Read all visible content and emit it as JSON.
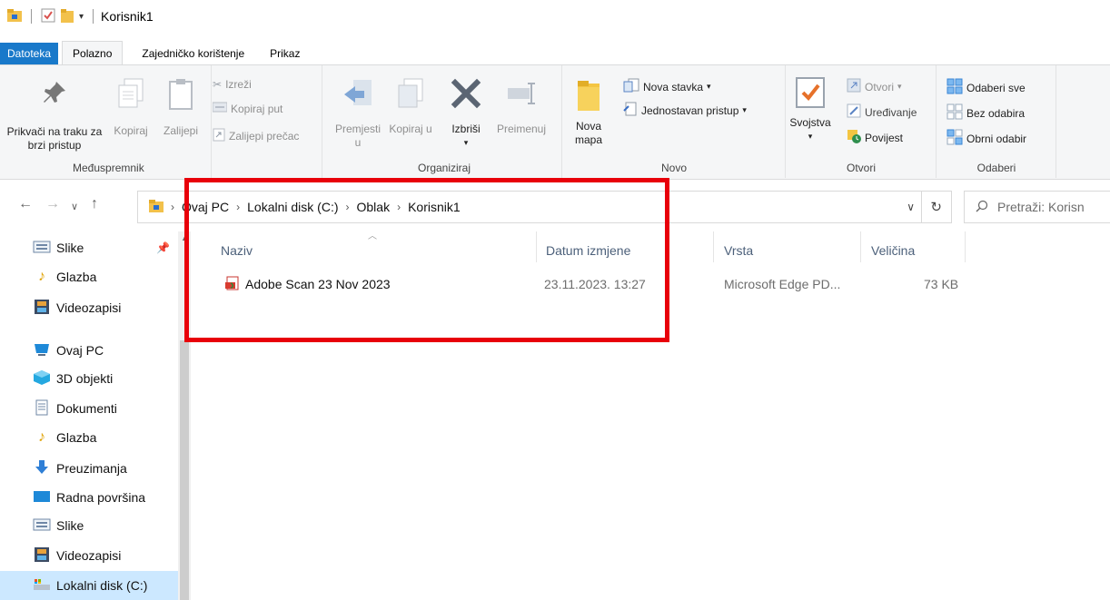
{
  "window": {
    "title": "Korisnik1"
  },
  "tabs": [
    "Datoteka",
    "Polazno",
    "Zajedničko korištenje",
    "Prikaz"
  ],
  "ribbon": {
    "clipboard": {
      "pin_label": "Prikvači na traku za brzi pristup",
      "copy": "Kopiraj",
      "paste": "Zalijepi",
      "cut": "Izreži",
      "copy_path": "Kopiraj put",
      "paste_shortcut": "Zalijepi prečac",
      "group": "Međuspremnik"
    },
    "organize": {
      "move_to": "Premjesti u",
      "copy_to": "Kopiraj u",
      "delete": "Izbriši",
      "rename": "Preimenuj",
      "group": "Organiziraj"
    },
    "new": {
      "new_folder": "Nova mapa",
      "new_item": "Nova stavka",
      "easy_access": "Jednostavan pristup",
      "group": "Novo"
    },
    "open": {
      "properties": "Svojstva",
      "open": "Otvori",
      "edit": "Uređivanje",
      "history": "Povijest",
      "group": "Otvori"
    },
    "select": {
      "select_all": "Odaberi sve",
      "select_none": "Bez odabira",
      "invert": "Obrni odabir",
      "group": "Odaberi"
    }
  },
  "address": {
    "crumbs": [
      "Ovaj PC",
      "Lokalni disk (C:)",
      "Oblak",
      "Korisnik1"
    ],
    "search_placeholder": "Pretraži: Korisn"
  },
  "sidebar": {
    "items": [
      "Slike",
      "Glazba",
      "Videozapisi",
      "Ovaj PC",
      "3D objekti",
      "Dokumenti",
      "Glazba",
      "Preuzimanja",
      "Radna površina",
      "Slike",
      "Videozapisi",
      "Lokalni disk (C:)"
    ]
  },
  "columns": {
    "name": "Naziv",
    "date": "Datum izmjene",
    "type": "Vrsta",
    "size": "Veličina"
  },
  "files": [
    {
      "name": "Adobe Scan 23 Nov 2023",
      "date": "23.11.2023. 13:27",
      "type": "Microsoft Edge PD...",
      "size": "73 KB"
    }
  ],
  "colors": {
    "file_tab": "#1979ca",
    "highlight": "#e8000a",
    "selected": "#cce8ff"
  }
}
